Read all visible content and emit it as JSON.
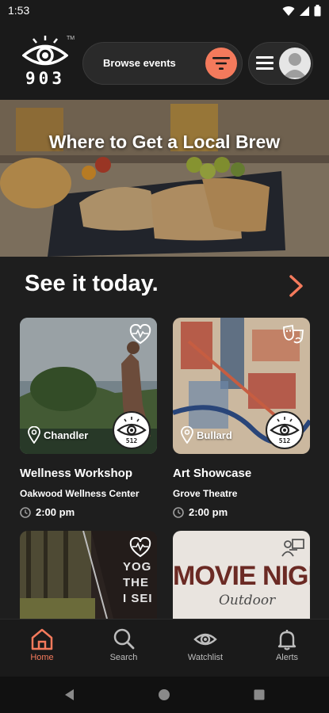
{
  "status_bar": {
    "time": "1:53"
  },
  "header": {
    "logo_text": "903",
    "logo_tm": "TM",
    "browse_label": "Browse events"
  },
  "hero": {
    "title": "Where to Get a Local Brew"
  },
  "section": {
    "title": "See it today."
  },
  "events": [
    {
      "location": "Chandler",
      "badge": "512",
      "title": "Wellness Workshop",
      "venue": "Oakwood Wellness Center",
      "time": "2:00 pm",
      "category_icon": "heart-pulse-icon"
    },
    {
      "location": "Bullard",
      "badge": "512",
      "title": "Art Showcase",
      "venue": "Grove Theatre",
      "time": "2:00 pm",
      "category_icon": "theater-masks-icon"
    },
    {
      "partial_text": "YOG THE I SEI",
      "category_icon": "heart-pulse-icon"
    },
    {
      "partial_text": "MOVIE NIGHT",
      "partial_script": "Outdoor",
      "category_icon": "presenter-icon"
    }
  ],
  "bottom_nav": {
    "items": [
      {
        "label": "Home",
        "icon": "home-icon",
        "active": true
      },
      {
        "label": "Search",
        "icon": "search-icon"
      },
      {
        "label": "Watchlist",
        "icon": "eye-icon"
      },
      {
        "label": "Alerts",
        "icon": "bell-icon"
      }
    ]
  },
  "colors": {
    "accent": "#f47a5c",
    "background": "#1e1e1e",
    "header": "#1a1a1a"
  }
}
